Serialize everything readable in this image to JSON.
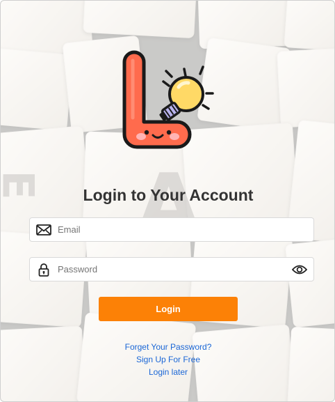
{
  "login": {
    "title": "Login to Your Account",
    "email_placeholder": "Email",
    "password_placeholder": "Password",
    "button_label": "Login"
  },
  "links": {
    "forgot": "Forget Your Password?",
    "signup": "Sign Up For Free",
    "later": "Login later"
  },
  "background_letters": [
    "E",
    "A"
  ],
  "icons": {
    "logo": "lightbulb-l-logo",
    "email": "envelope-icon",
    "password": "padlock-icon",
    "toggle": "eye-icon"
  },
  "colors": {
    "accent": "#fc8106",
    "link": "#1a66d6",
    "title": "#333333"
  }
}
